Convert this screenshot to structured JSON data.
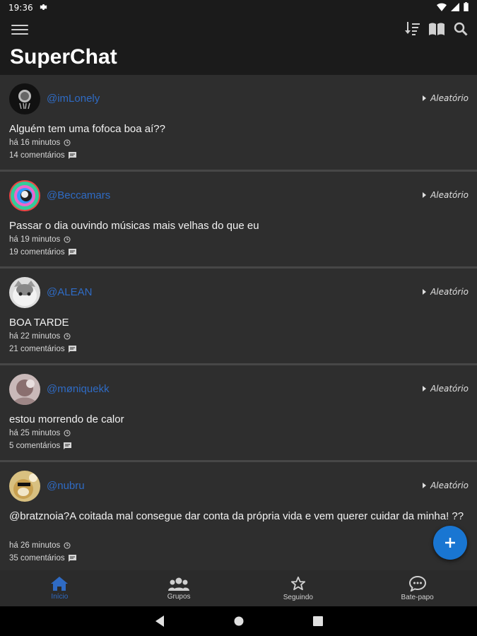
{
  "status_bar": {
    "time": "19:36",
    "icons": [
      "settings-icon",
      "wifi-icon",
      "signal-icon",
      "battery-icon"
    ]
  },
  "app": {
    "title": "SuperChat",
    "accent_color": "#1976d2",
    "username_color": "#2f6bc4"
  },
  "toolbar": {
    "actions": [
      "sort-icon",
      "book-icon",
      "search-icon"
    ]
  },
  "posts": [
    {
      "username": "@imLonely",
      "category": "Aleatório",
      "text": "Alguém tem uma fofoca boa aí??",
      "time": "há 16 minutos",
      "comments": "14 comentários"
    },
    {
      "username": "@Beccamars",
      "category": "Aleatório",
      "text": "Passar o dia ouvindo músicas mais velhas do que eu",
      "time": "há 19 minutos",
      "comments": "19 comentários"
    },
    {
      "username": "@ALEAN",
      "category": "Aleatório",
      "text": "BOA TARDE",
      "time": "há 22 minutos",
      "comments": "21 comentários"
    },
    {
      "username": "@møniquekk",
      "category": "Aleatório",
      "text": "estou morrendo de calor",
      "time": "há 25 minutos",
      "comments": "5 comentários"
    },
    {
      "username": "@nubru",
      "category": "Aleatório",
      "text": "@bratznoia?A coitada mal consegue dar conta da própria vida e vem querer cuidar da minha! ??",
      "time": "há 26 minutos",
      "comments": "35 comentários"
    }
  ],
  "fab": {
    "label": "+"
  },
  "bottom_nav": [
    {
      "label": "Início",
      "icon": "home-icon",
      "active": true
    },
    {
      "label": "Grupos",
      "icon": "groups-icon",
      "active": false
    },
    {
      "label": "Seguindo",
      "icon": "star-icon",
      "active": false
    },
    {
      "label": "Bate-papo",
      "icon": "chat-bubble-icon",
      "active": false
    }
  ]
}
